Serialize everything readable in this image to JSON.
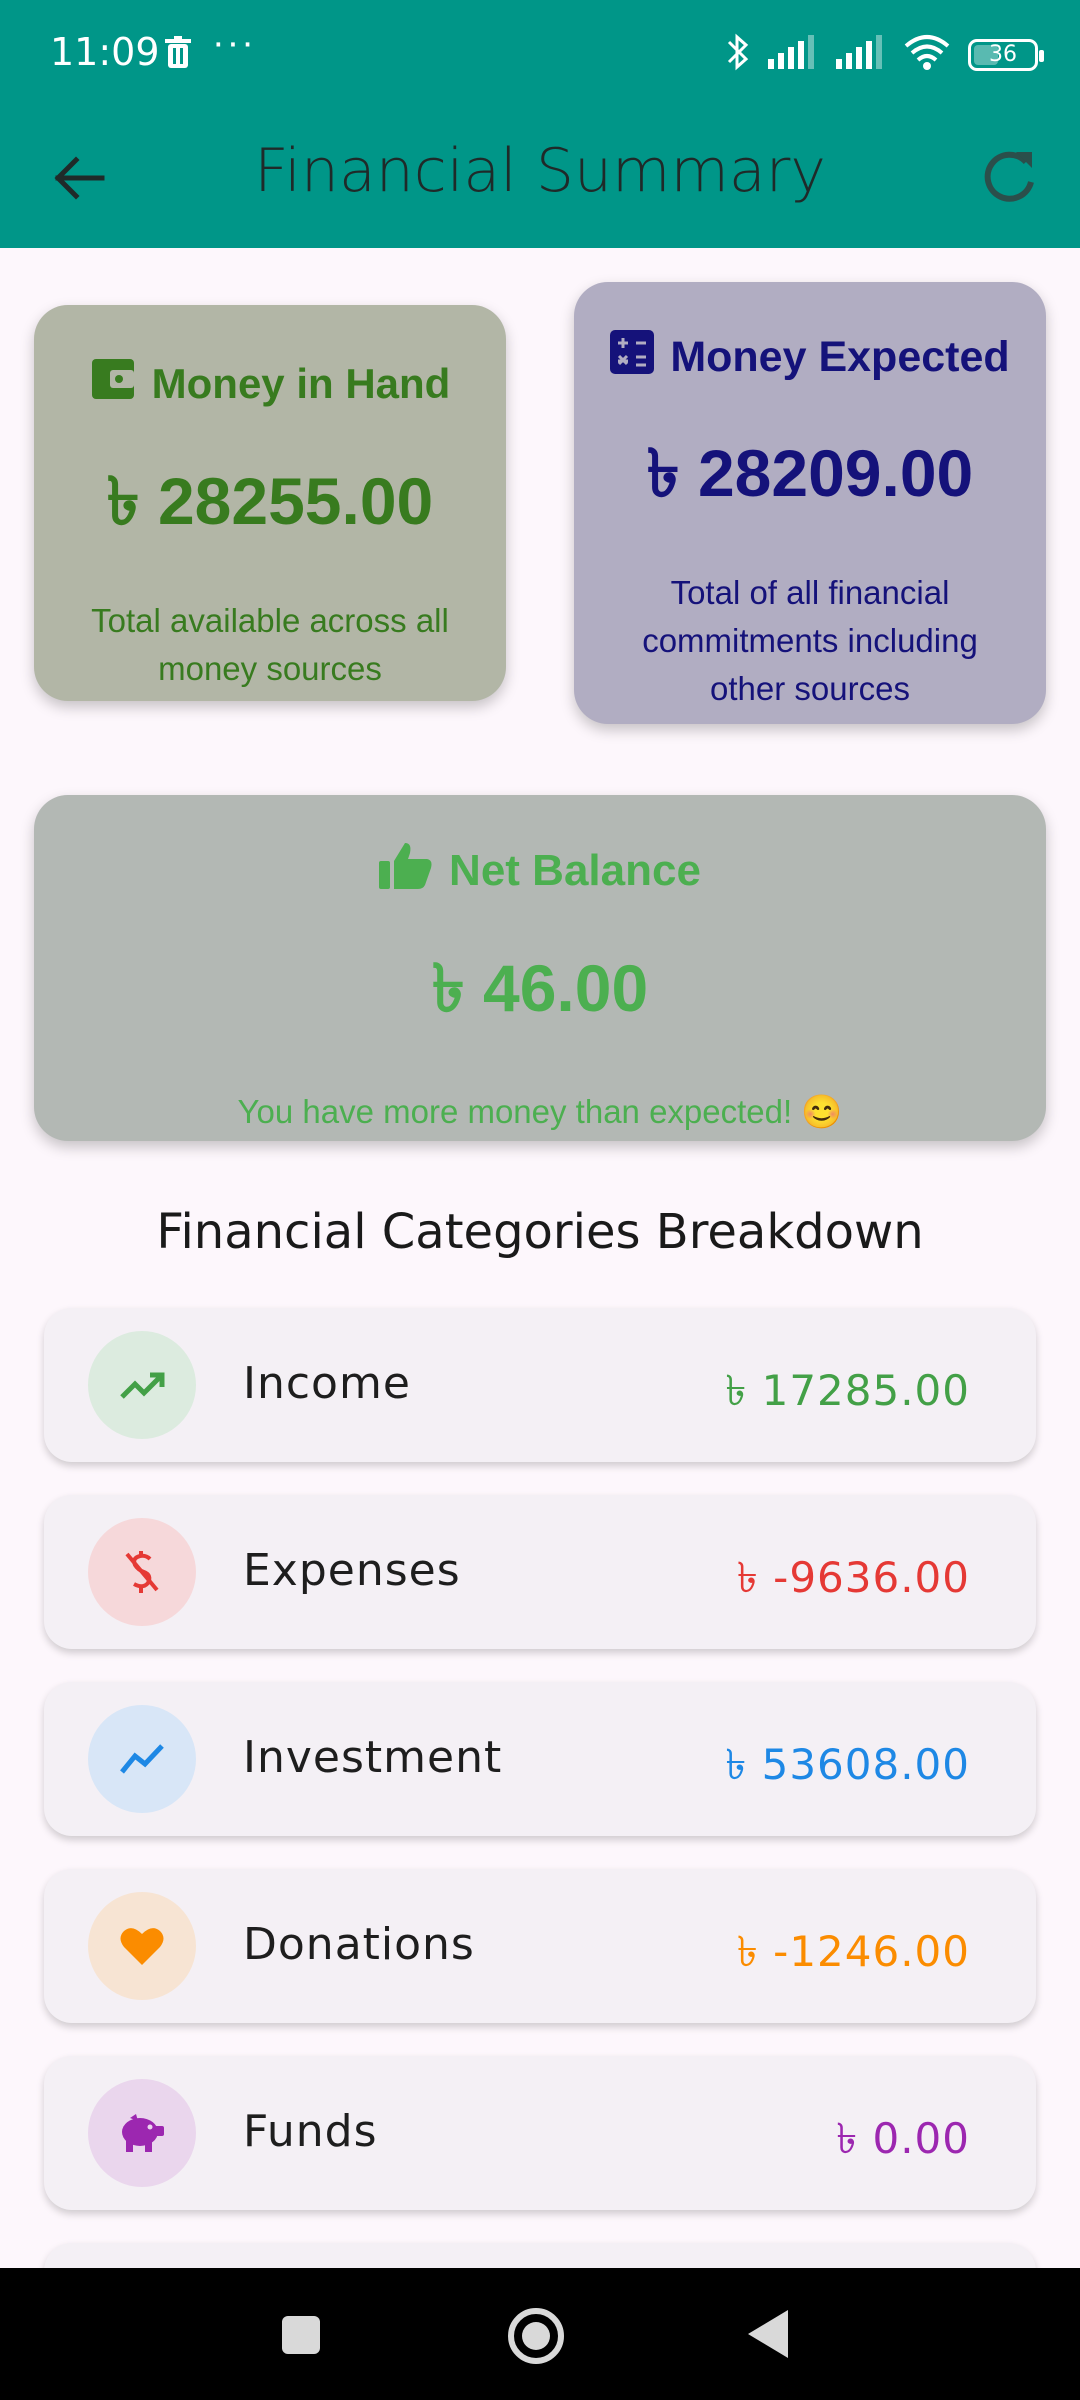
{
  "status_bar": {
    "time": "11:09",
    "overflow": "···",
    "battery_level": "36",
    "icons": [
      "trash-icon",
      "bluetooth-icon",
      "signal-icon",
      "signal-icon",
      "wifi-icon",
      "battery-icon"
    ]
  },
  "app_bar": {
    "title": "Financial Summary",
    "back_icon": "arrow-back-icon",
    "refresh_icon": "refresh-icon"
  },
  "money_in_hand": {
    "title": "Money in Hand",
    "amount": "৳ 28255.00",
    "description": "Total available across all money sources",
    "icon": "wallet-icon",
    "color": "#387b1f"
  },
  "money_expected": {
    "title": "Money Expected",
    "amount": "৳ 28209.00",
    "description": "Total of all financial commitments including other sources",
    "icon": "calculator-icon",
    "color": "#15127a"
  },
  "net_balance": {
    "title": "Net Balance",
    "amount": "৳ 46.00",
    "description": "You have more money than expected! 😊",
    "icon": "thumbs-up-icon",
    "color": "#4caf50"
  },
  "breakdown": {
    "title": "Financial Categories Breakdown",
    "items": [
      {
        "label": "Income",
        "value": "৳ 17285.00",
        "icon": "trending-up-icon",
        "color": "#43a047",
        "bg": "#dcebdf"
      },
      {
        "label": "Expenses",
        "value": "৳ -9636.00",
        "icon": "money-off-icon",
        "color": "#e53935",
        "bg": "#f6d8da"
      },
      {
        "label": "Investment",
        "value": "৳ 53608.00",
        "icon": "show-chart-icon",
        "color": "#1e88e5",
        "bg": "#d8e6f7"
      },
      {
        "label": "Donations",
        "value": "৳ -1246.00",
        "icon": "heart-icon",
        "color": "#fb8c00",
        "bg": "#f7e4d3"
      },
      {
        "label": "Funds",
        "value": "৳ 0.00",
        "icon": "piggy-bank-icon",
        "color": "#9c27b0",
        "bg": "#ead6ed"
      }
    ]
  },
  "nav_bar": {
    "icons": [
      "recent-apps-icon",
      "home-icon",
      "back-icon"
    ]
  }
}
